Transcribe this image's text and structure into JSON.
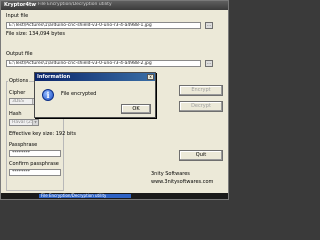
{
  "window": {
    "title": "Kryptor4tw",
    "path": "- File Encryption/Decryption utility"
  },
  "input": {
    "label": "Input file",
    "value": "E:\\Test\\Pictures\\1\\arduino-cnc-shield-v3-0-uno-r3-4-a4988-1.jpg",
    "browse_label": "...",
    "size_label": "File size: 134,094 bytes"
  },
  "output": {
    "label": "Output file",
    "value": "E:\\Test\\Pictures\\1\\arduino-cnc-shield-v3-0-uno-r3-4-a4988-2.jpg",
    "browse_label": "..."
  },
  "options": {
    "label": "Options",
    "cipher_label": "Cipher",
    "cipher_value": "3DES",
    "hash_label": "Hash",
    "hash_value": "Haval (256",
    "keysize_label": "Effective key size: 192 bits",
    "pass_label": "Passphrase",
    "pass_value": "********",
    "confirm_label": "Confirm passphrase",
    "confirm_value": "********"
  },
  "buttons": {
    "encrypt": "Encrypt",
    "decrypt": "Decrypt",
    "quit": "Quit"
  },
  "credits": {
    "line1": "3nity Softwares",
    "line2": "www.3nitysoftwares.com"
  },
  "dialog": {
    "title": "Information",
    "close_label": "x",
    "message": "File encrypted",
    "ok_label": "OK",
    "icon_glyph": "i"
  },
  "taskbar": {
    "label": "File Encryption/Decryption utility"
  }
}
